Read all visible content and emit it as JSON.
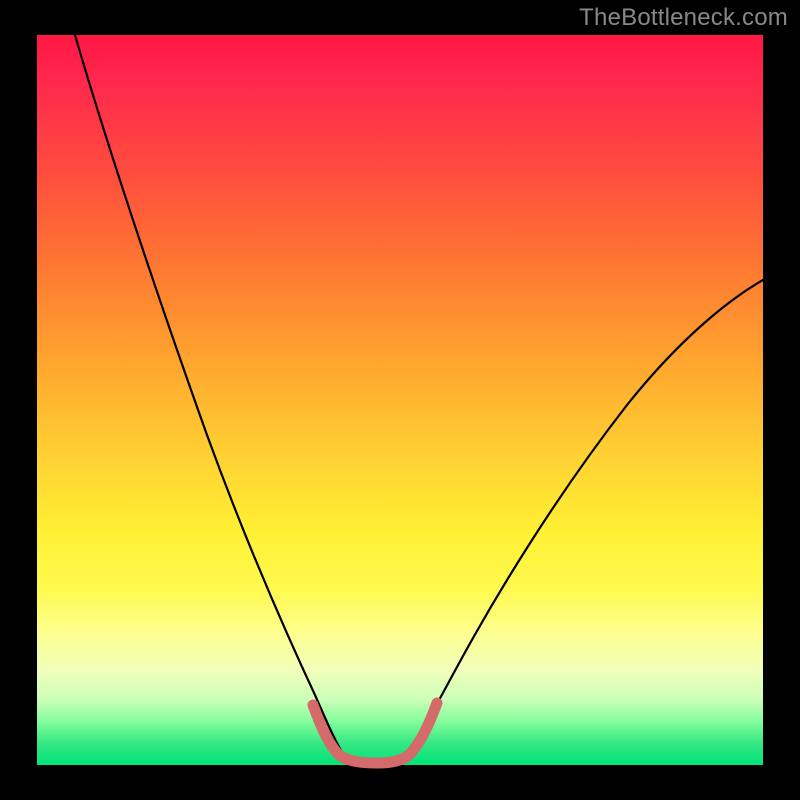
{
  "watermark": "TheBottleneck.com",
  "chart_data": {
    "type": "line",
    "title": "",
    "xlabel": "",
    "ylabel": "",
    "xlim": [
      0,
      100
    ],
    "ylim": [
      0,
      100
    ],
    "series": [
      {
        "name": "left-curve",
        "x": [
          5,
          9,
          13,
          17,
          21,
          25,
          29,
          33,
          36,
          38,
          40,
          42
        ],
        "y": [
          100,
          86,
          72,
          59,
          47,
          36,
          26,
          17,
          10,
          6,
          3,
          1
        ]
      },
      {
        "name": "right-curve",
        "x": [
          50,
          53,
          57,
          62,
          68,
          75,
          82,
          90,
          100
        ],
        "y": [
          1,
          4,
          10,
          18,
          28,
          38,
          48,
          57,
          66
        ]
      },
      {
        "name": "bottom-highlight",
        "x": [
          38,
          40,
          42,
          44,
          46,
          48,
          50,
          52,
          54
        ],
        "y": [
          7,
          3,
          1,
          0.5,
          0.5,
          0.5,
          1,
          3,
          7
        ]
      }
    ],
    "colors": {
      "gradient_top": "#ff1744",
      "gradient_mid": "#fff033",
      "gradient_bottom": "#00e379",
      "curve": "#000000",
      "highlight": "#d86a6a",
      "frame": "#000000"
    }
  }
}
